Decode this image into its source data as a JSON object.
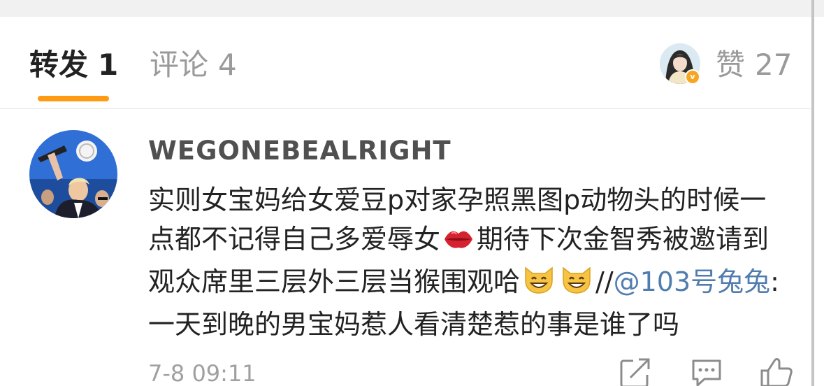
{
  "tabs": {
    "repost": {
      "label": "转发",
      "count": "1"
    },
    "comment": {
      "label": "评论",
      "count": "4"
    },
    "likes": {
      "label": "赞",
      "count": "27"
    }
  },
  "comment": {
    "username": "WEGONEBEALRIGHT",
    "lines": {
      "l1": "实则女宝妈给女爱豆p对家孕照黑图p动物头的时候一",
      "l2a": "点都不记得自己多爱辱女",
      "l2b": "期待下次金智秀被邀请到",
      "l3a": "观众席里三层外三层当猴围观哈",
      "l3b": "//",
      "l3c": "@103号兔兔",
      "l3d": ":",
      "l4": "一天到晚的男宝妈惹人看清楚惹的事是谁了吗"
    },
    "emojis": [
      "lips-emoji",
      "grinning-cat-emoji",
      "grinning-cat-emoji"
    ],
    "timestamp": "7-8 09:11"
  },
  "colors": {
    "accent_underline": "#ff9a12",
    "mention": "#507daf",
    "verified_badge": "#f6a623"
  },
  "icons": [
    "share-icon",
    "comment-icon",
    "like-icon"
  ]
}
